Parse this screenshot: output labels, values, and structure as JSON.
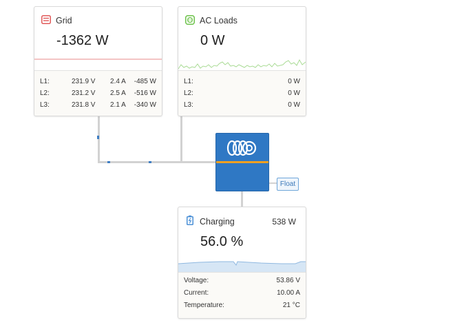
{
  "grid": {
    "title": "Grid",
    "value": "-1362 W",
    "rows": [
      {
        "label": "L1:",
        "voltage": "231.9 V",
        "current": "2.4 A",
        "power": "-485 W"
      },
      {
        "label": "L2:",
        "voltage": "231.2 V",
        "current": "2.5 A",
        "power": "-516 W"
      },
      {
        "label": "L3:",
        "voltage": "231.8 V",
        "current": "2.1 A",
        "power": "-340 W"
      }
    ]
  },
  "ac_loads": {
    "title": "AC Loads",
    "value": "0 W",
    "rows": [
      {
        "label": "L1:",
        "power": "0 W"
      },
      {
        "label": "L2:",
        "power": "0 W"
      },
      {
        "label": "L3:",
        "power": "0 W"
      }
    ]
  },
  "inverter": {
    "state": "Float"
  },
  "battery": {
    "title": "Charging",
    "power": "538 W",
    "soc": "56.0 %",
    "rows": [
      {
        "label": "Voltage:",
        "value": "53.86 V"
      },
      {
        "label": "Current:",
        "value": "10.00 A"
      },
      {
        "label": "Temperature:",
        "value": "21 °C"
      }
    ]
  },
  "colors": {
    "grid_accent": "#e05a5a",
    "ac_loads_accent": "#6cc24a",
    "battery_accent": "#4a8fd6",
    "inverter_blue": "#2f78c4",
    "inverter_stripe": "#f0a020"
  },
  "icons": {
    "grid": "grid-meter-icon",
    "ac_loads": "socket-icon",
    "battery": "battery-icon",
    "inverter": "victron-logo"
  }
}
